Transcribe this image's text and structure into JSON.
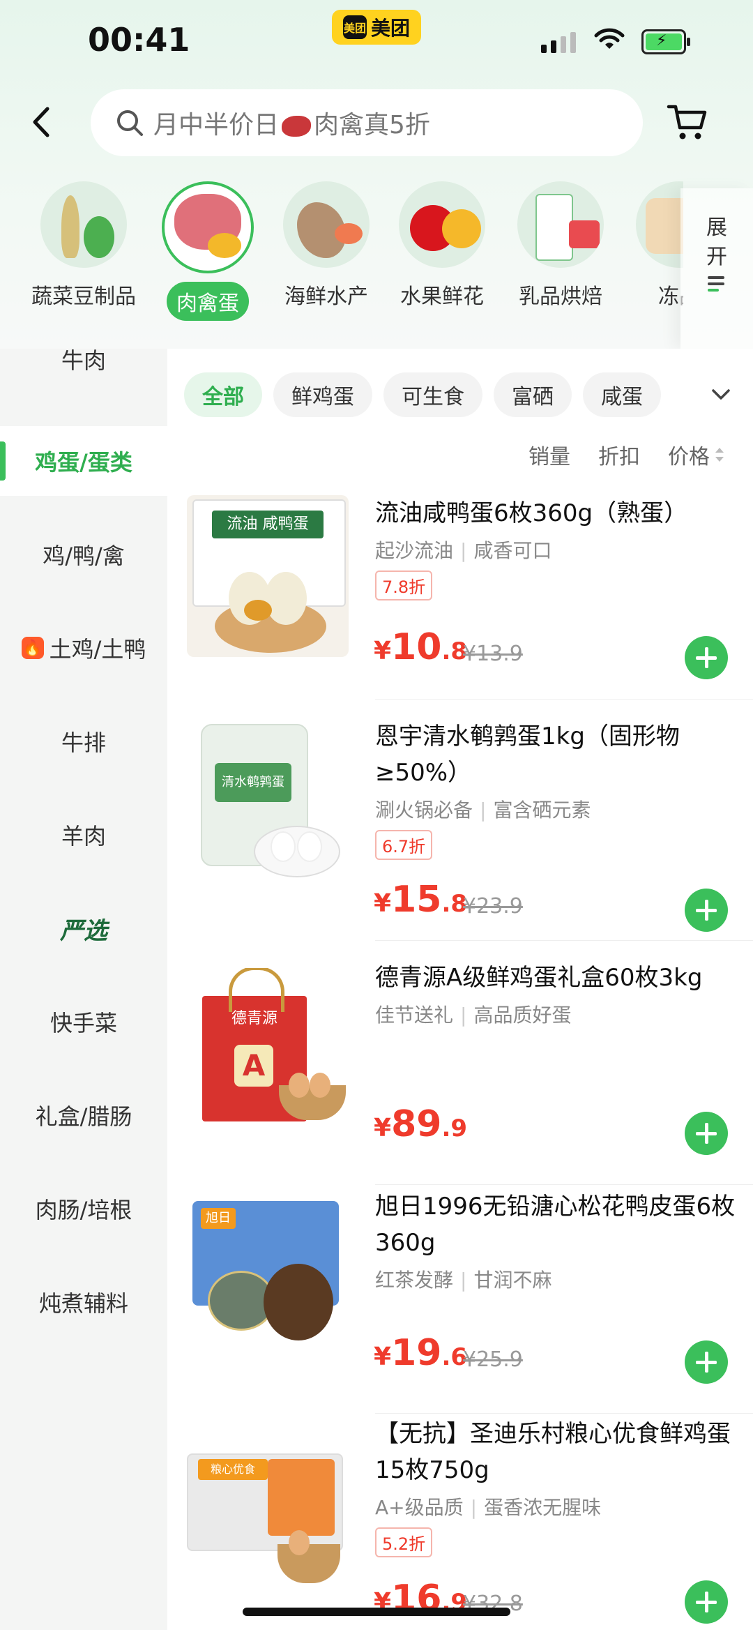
{
  "status_bar": {
    "time": "00:41",
    "app_logo": "美团",
    "app_name": "美团"
  },
  "search": {
    "placeholder_before": "月中半价日",
    "placeholder_after": "肉禽真5折"
  },
  "categories": [
    {
      "label": "蔬菜豆制品",
      "active": false
    },
    {
      "label": "肉禽蛋",
      "active": true
    },
    {
      "label": "海鲜水产",
      "active": false
    },
    {
      "label": "水果鲜花",
      "active": false
    },
    {
      "label": "乳品烘焙",
      "active": false
    },
    {
      "label": "冻品",
      "active": false
    }
  ],
  "expand": {
    "line1": "展",
    "line2": "开"
  },
  "sidebar": {
    "items": [
      {
        "label": "牛肉"
      },
      {
        "label": "鸡蛋/蛋类",
        "active": true
      },
      {
        "label": "鸡/鸭/禽"
      },
      {
        "label": "土鸡/土鸭",
        "icon": "fire-icon"
      },
      {
        "label": "牛排"
      },
      {
        "label": "羊肉"
      },
      {
        "label": "严选",
        "brand": true
      },
      {
        "label": "快手菜"
      },
      {
        "label": "礼盒/腊肠"
      },
      {
        "label": "肉肠/培根"
      },
      {
        "label": "炖煮辅料"
      }
    ]
  },
  "filters": [
    {
      "label": "全部",
      "active": true
    },
    {
      "label": "鲜鸡蛋"
    },
    {
      "label": "可生食"
    },
    {
      "label": "富硒"
    },
    {
      "label": "咸蛋"
    }
  ],
  "sort": {
    "sales": "销量",
    "discount": "折扣",
    "price": "价格"
  },
  "products": [
    {
      "title": "流油咸鸭蛋6枚360g（熟蛋）",
      "tag1": "起沙流油",
      "tag2": "咸香可口",
      "discount": "7.8折",
      "currency": "¥",
      "price_int": "10",
      "price_dec": ".8",
      "original": "¥13.9",
      "image_text": "流油 咸鸭蛋"
    },
    {
      "title": "恩宇清水鹌鹑蛋1kg（固形物≥50%）",
      "tag1": "涮火锅必备",
      "tag2": "富含硒元素",
      "discount": "6.7折",
      "currency": "¥",
      "price_int": "15",
      "price_dec": ".8",
      "original": "¥23.9",
      "image_text": "清水鹌鹑蛋"
    },
    {
      "title": "德青源A级鲜鸡蛋礼盒60枚3kg",
      "tag1": "佳节送礼",
      "tag2": "高品质好蛋",
      "discount": "",
      "currency": "¥",
      "price_int": "89",
      "price_dec": ".9",
      "original": "",
      "image_text": "德青源"
    },
    {
      "title": "旭日1996无铅溏心松花鸭皮蛋6枚360g",
      "tag1": "红茶发酵",
      "tag2": "甘润不麻",
      "discount": "",
      "currency": "¥",
      "price_int": "19",
      "price_dec": ".6",
      "original": "¥25.9",
      "image_text": "旭日"
    },
    {
      "title": "【无抗】圣迪乐村粮心优食鲜鸡蛋15枚750g",
      "tag1": "A+级品质",
      "tag2": "蛋香浓无腥味",
      "discount": "5.2折",
      "currency": "¥",
      "price_int": "16",
      "price_dec": ".9",
      "original": "¥32.8",
      "image_text": "粮心优食"
    }
  ],
  "colors": {
    "accent": "#3bbf5b",
    "price": "#ef3b2c",
    "sidebar_bg": "#f4f5f4"
  }
}
